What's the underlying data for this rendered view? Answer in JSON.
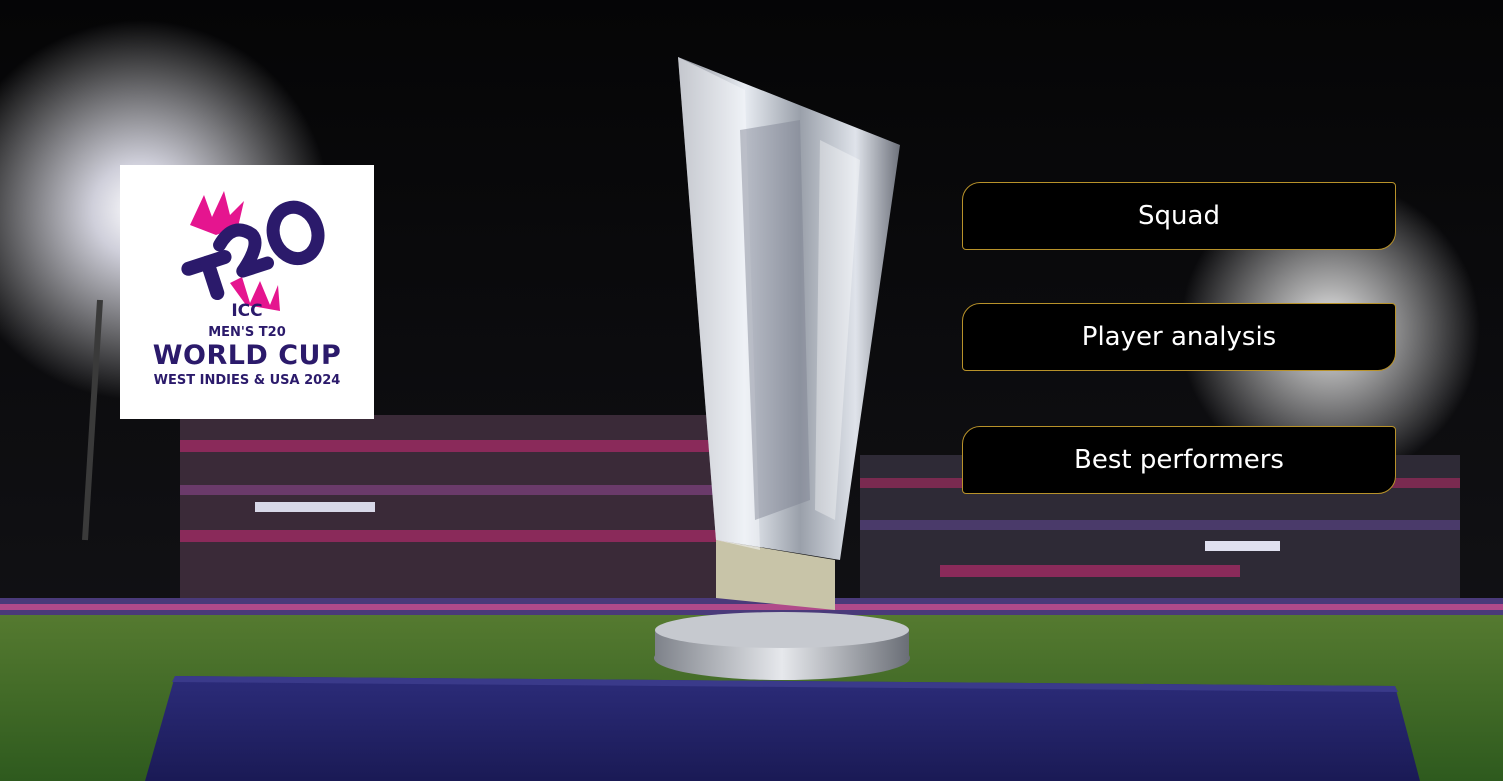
{
  "logo": {
    "icc": "ICC",
    "mens": "MEN'S T20",
    "title": "WORLD CUP",
    "venue": "WEST INDIES & USA 2024",
    "mark_text": "T20",
    "colors": {
      "navy": "#2b1a6b",
      "magenta": "#e5158f"
    }
  },
  "nav": {
    "squad": "Squad",
    "player_analysis": "Player analysis",
    "best_performers": "Best performers"
  },
  "colors": {
    "button_bg": "#000000",
    "button_border": "#b8922a",
    "button_text": "#ffffff",
    "pitch_green": "#3d6b2a",
    "plinth_blue": "#22226a"
  }
}
